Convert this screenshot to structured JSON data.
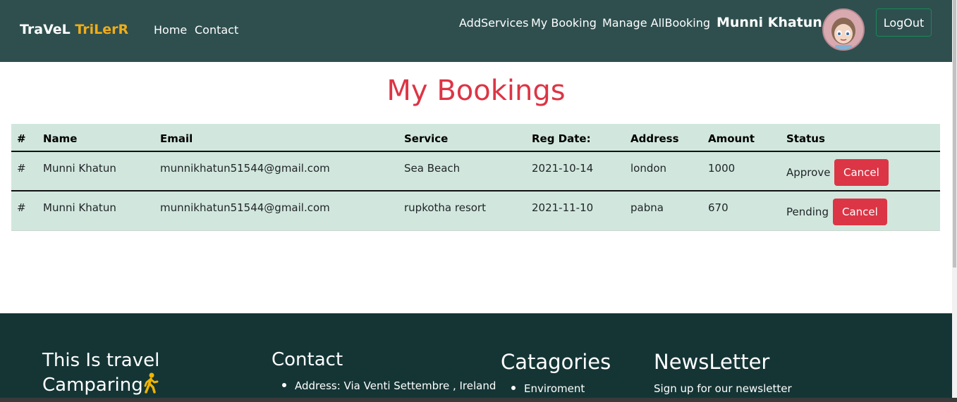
{
  "navbar": {
    "brand_part1": "TraVeL",
    "brand_part2": "TriLerR",
    "links_left": [
      "Home",
      "Contact"
    ],
    "links_right": [
      "AddServices",
      "My Booking",
      "Manage AllBooking"
    ],
    "user_name": "Munni Khatun",
    "logout_label": "LogOut"
  },
  "page_title": "My Bookings",
  "table": {
    "headers": [
      "#",
      "Name",
      "Email",
      "Service",
      "Reg Date:",
      "Address",
      "Amount",
      "Status"
    ],
    "rows": [
      {
        "num": "#",
        "name": "Munni Khatun",
        "email": "munnikhatun51544@gmail.com",
        "service": "Sea Beach",
        "date": "2021-10-14",
        "address": "london",
        "amount": "1000",
        "status": "Approve",
        "action": "Cancel"
      },
      {
        "num": "#",
        "name": "Munni Khatun",
        "email": "munnikhatun51544@gmail.com",
        "service": "rupkotha resort",
        "date": "2021-11-10",
        "address": "pabna",
        "amount": "670",
        "status": "Pending",
        "action": "Cancel"
      }
    ]
  },
  "footer": {
    "about_title_line1": "This Is travel",
    "about_title_line2": "Camparing",
    "contact_title": "Contact",
    "contact_items": [
      "Address: Via Venti Settembre , Ireland"
    ],
    "categories_title": "Catagories",
    "categories_items": [
      "Enviroment"
    ],
    "newsletter_title": "NewsLetter",
    "newsletter_text": "Sign up for our newsletter"
  },
  "colors": {
    "navbar_bg": "#2f4f4f",
    "brand_accent": "#f0ad17",
    "title_red": "#dc3545",
    "table_bg": "#d1e7dd",
    "footer_bg": "#153535",
    "cancel_btn": "#dc3545"
  }
}
